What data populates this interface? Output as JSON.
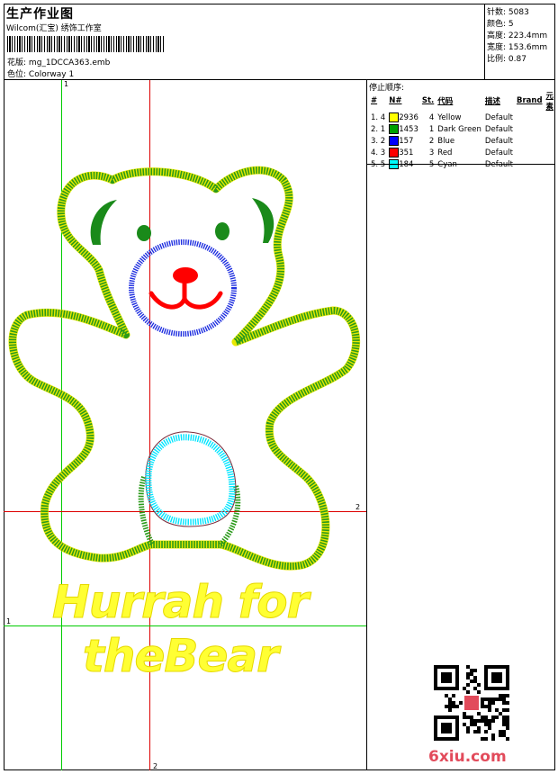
{
  "header": {
    "title": "生产作业图",
    "company": "Wilcom(汇宝) 绣饰工作室",
    "design_label": "花版:",
    "design_value": "mg_1DCCA363.emb",
    "color_label": "色位:",
    "color_value": "Colorway 1"
  },
  "stats": {
    "stitches": "针数: 5083",
    "colors": "颜色: 5",
    "height": "高度: 223.4mm",
    "width": "宽度: 153.6mm",
    "scale": "比例: 0.87"
  },
  "stop_sequence": {
    "title": "停止顺序:",
    "headers": [
      "#",
      "N#",
      "St.",
      "代码",
      "描述",
      "Brand",
      "元素"
    ],
    "rows": [
      {
        "idx": "1. 4",
        "color": "#ffff00",
        "st": "2936",
        "code": "4",
        "desc": "Yellow",
        "brand": "Default"
      },
      {
        "idx": "2. 1",
        "color": "#00a000",
        "st": "1453",
        "code": "1",
        "desc": "Dark Green",
        "brand": "Default"
      },
      {
        "idx": "3. 2",
        "color": "#0000ff",
        "st": "157",
        "code": "2",
        "desc": "Blue",
        "brand": "Default"
      },
      {
        "idx": "4. 3",
        "color": "#ff0000",
        "st": "351",
        "code": "3",
        "desc": "Red",
        "brand": "Default"
      },
      {
        "idx": "5. 5",
        "color": "#00ffff",
        "st": "184",
        "code": "5",
        "desc": "Cyan",
        "brand": "Default"
      }
    ]
  },
  "guides": {
    "v1_label": "1",
    "v2_label": "2",
    "h1_label": "1",
    "h2_label": "2"
  },
  "design_text": {
    "line1": "Hurrah for",
    "line2": "theBear"
  },
  "watermark": "6xiu.com",
  "colors": {
    "green_guide": "#00cc00",
    "red_guide": "#dd0000",
    "yellow": "#ffff00",
    "dark_green": "#109010",
    "blue": "#2030e0",
    "red": "#ff0000",
    "cyan": "#00e5ff"
  }
}
